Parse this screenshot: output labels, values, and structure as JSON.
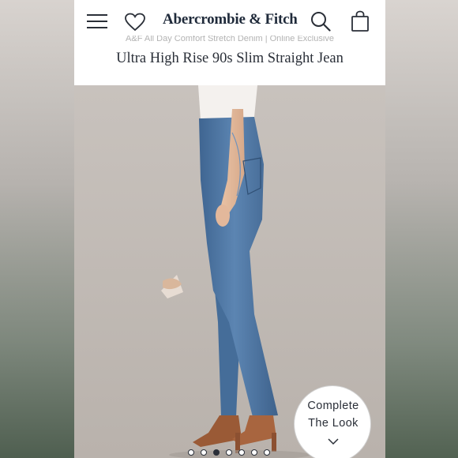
{
  "header": {
    "brand": "Abercrombie & Fitch",
    "subline": "A&F All Day Comfort Stretch Denim | Online Exclusive",
    "title": "Ultra High Rise 90s Slim Straight Jean"
  },
  "icons": {
    "menu": "hamburger-menu-icon",
    "wishlist": "heart-icon",
    "search": "search-icon",
    "bag": "shopping-bag-icon"
  },
  "complete_look": {
    "line1": "Complete",
    "line2": "The Look",
    "icon": "chevron-down-icon"
  },
  "carousel": {
    "count": 7,
    "active_index": 2
  },
  "colors": {
    "brand_navy": "#1f2a3a",
    "denim": "#4f77a3"
  }
}
